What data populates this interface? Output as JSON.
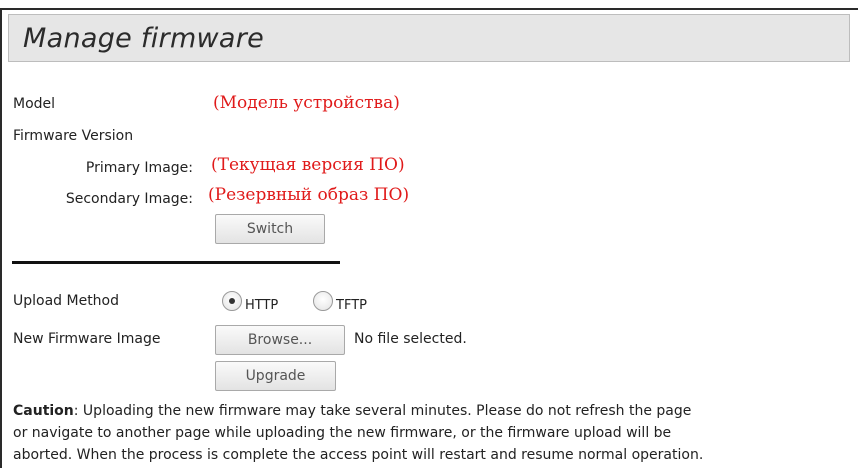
{
  "page": {
    "title": "Manage firmware"
  },
  "device": {
    "model_label": "Model",
    "model_value": "(Модель устройства)",
    "firmware_version_label": "Firmware Version",
    "primary_label": "Primary Image:",
    "primary_value": "(Текущая версия ПО)",
    "secondary_label": "Secondary Image:",
    "secondary_value": "(Резервный образ ПО)",
    "switch_button": "Switch"
  },
  "upload": {
    "method_label": "Upload Method",
    "options": [
      {
        "label": "HTTP",
        "selected": true
      },
      {
        "label": "TFTP",
        "selected": false
      }
    ],
    "new_image_label": "New Firmware Image",
    "browse_button": "Browse...",
    "file_status": "No file selected.",
    "upgrade_button": "Upgrade"
  },
  "caution": {
    "label": "Caution",
    "lines": [
      ": Uploading the new firmware may take several minutes. Please do not refresh the page",
      "or navigate to another page while uploading the new firmware, or the firmware upload will be",
      "aborted. When the process is complete the access point will restart and resume normal operation."
    ]
  },
  "colors": {
    "annotation_red": "#e01a1a",
    "title_bar_bg": "#e6e6e6"
  }
}
